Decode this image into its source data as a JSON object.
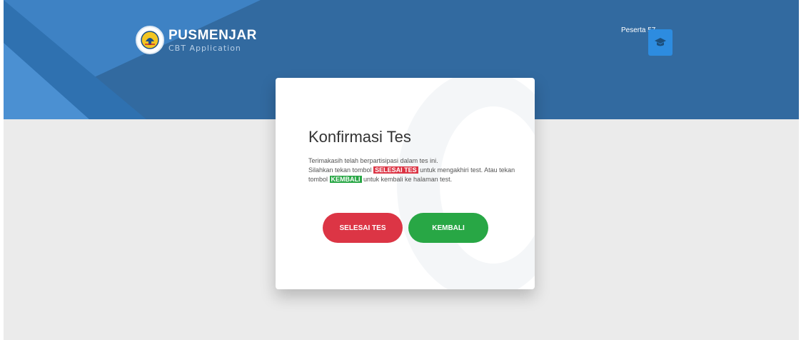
{
  "header": {
    "brand_title": "PUSMENJAR",
    "brand_subtitle": "CBT Application",
    "user_name": "Peserta 57",
    "logo_icon": "tut-wuri-handayani-logo",
    "user_icon": "graduation-cap-icon"
  },
  "dialog": {
    "title": "Konfirmasi Tes",
    "line1": "Terimakasih telah berpartisipasi dalam tes ini.",
    "line2_before": "Silahkan tekan tombol ",
    "line2_highlight": "SELESAI TES",
    "line2_after": " untuk mengakhiri test. Atau tekan",
    "line3_before": "tombol ",
    "line3_highlight": "KEMBALI",
    "line3_after": " untuk kembali ke halaman test."
  },
  "buttons": {
    "finish_label": "SELESAI TES",
    "back_label": "KEMBALI"
  },
  "colors": {
    "header_blue": "#326aa0",
    "danger": "#dc3545",
    "success": "#28a745",
    "user_icon_bg": "#2d8ce0",
    "page_bg": "#ebebeb"
  }
}
